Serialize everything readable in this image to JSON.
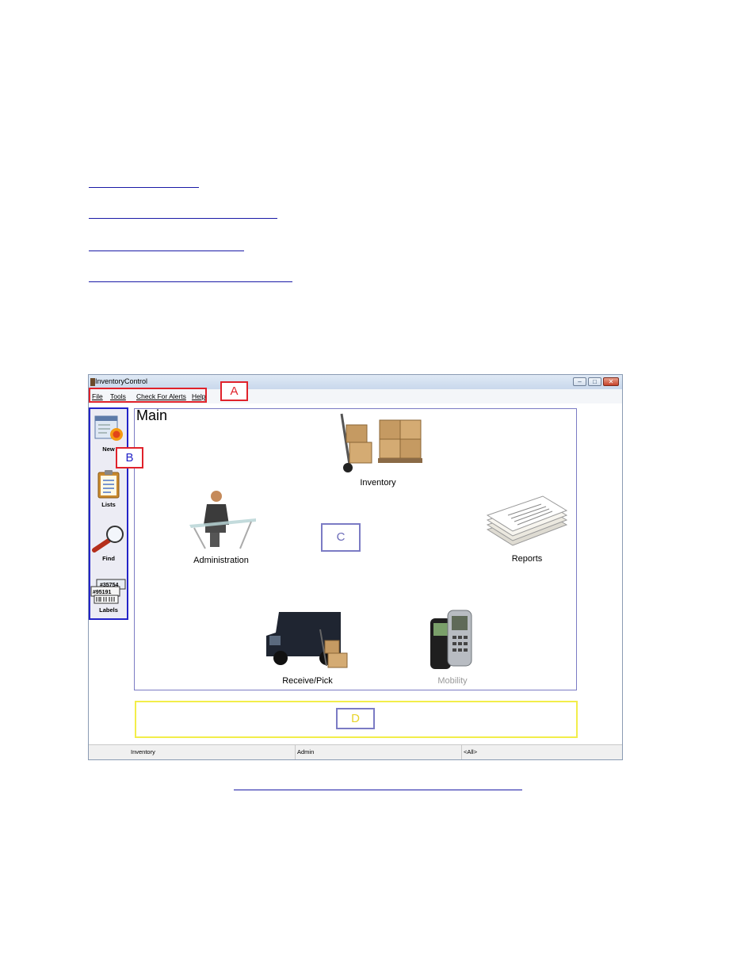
{
  "window": {
    "title": "InventoryControl",
    "buttons": [
      "minimize",
      "maximize",
      "close"
    ]
  },
  "menu": {
    "items": [
      {
        "label": "File"
      },
      {
        "label": "Tools"
      },
      {
        "label": "Check For Alerts"
      },
      {
        "label": "Help"
      }
    ]
  },
  "sidebar": {
    "items": [
      {
        "label": "New",
        "icon": "new-icon"
      },
      {
        "label": "Lists",
        "icon": "clipboard-icon"
      },
      {
        "label": "Find",
        "icon": "magnifier-icon"
      },
      {
        "label": "Labels",
        "icon": "barcode-labels-icon"
      }
    ]
  },
  "main": {
    "title": "Main",
    "tiles": [
      {
        "label": "Inventory",
        "icon": "boxes-handtruck-icon",
        "enabled": true
      },
      {
        "label": "Administration",
        "icon": "office-person-icon",
        "enabled": true
      },
      {
        "label": "Reports",
        "icon": "paper-stack-icon",
        "enabled": true
      },
      {
        "label": "Receive/Pick",
        "icon": "delivery-truck-icon",
        "enabled": true
      },
      {
        "label": "Mobility",
        "icon": "handheld-scanner-icon",
        "enabled": false
      }
    ]
  },
  "status": {
    "cells": [
      "Inventory",
      "Admin",
      "<All>"
    ]
  },
  "callouts": {
    "a": "A",
    "b": "B",
    "c": "C",
    "d": "D"
  },
  "colors": {
    "callout_red": "#e0222b",
    "callout_blue": "#2323c8",
    "callout_purple": "#7b7bc4",
    "callout_yellow": "#f2ee4a",
    "link_blue": "#1a1aa6"
  }
}
